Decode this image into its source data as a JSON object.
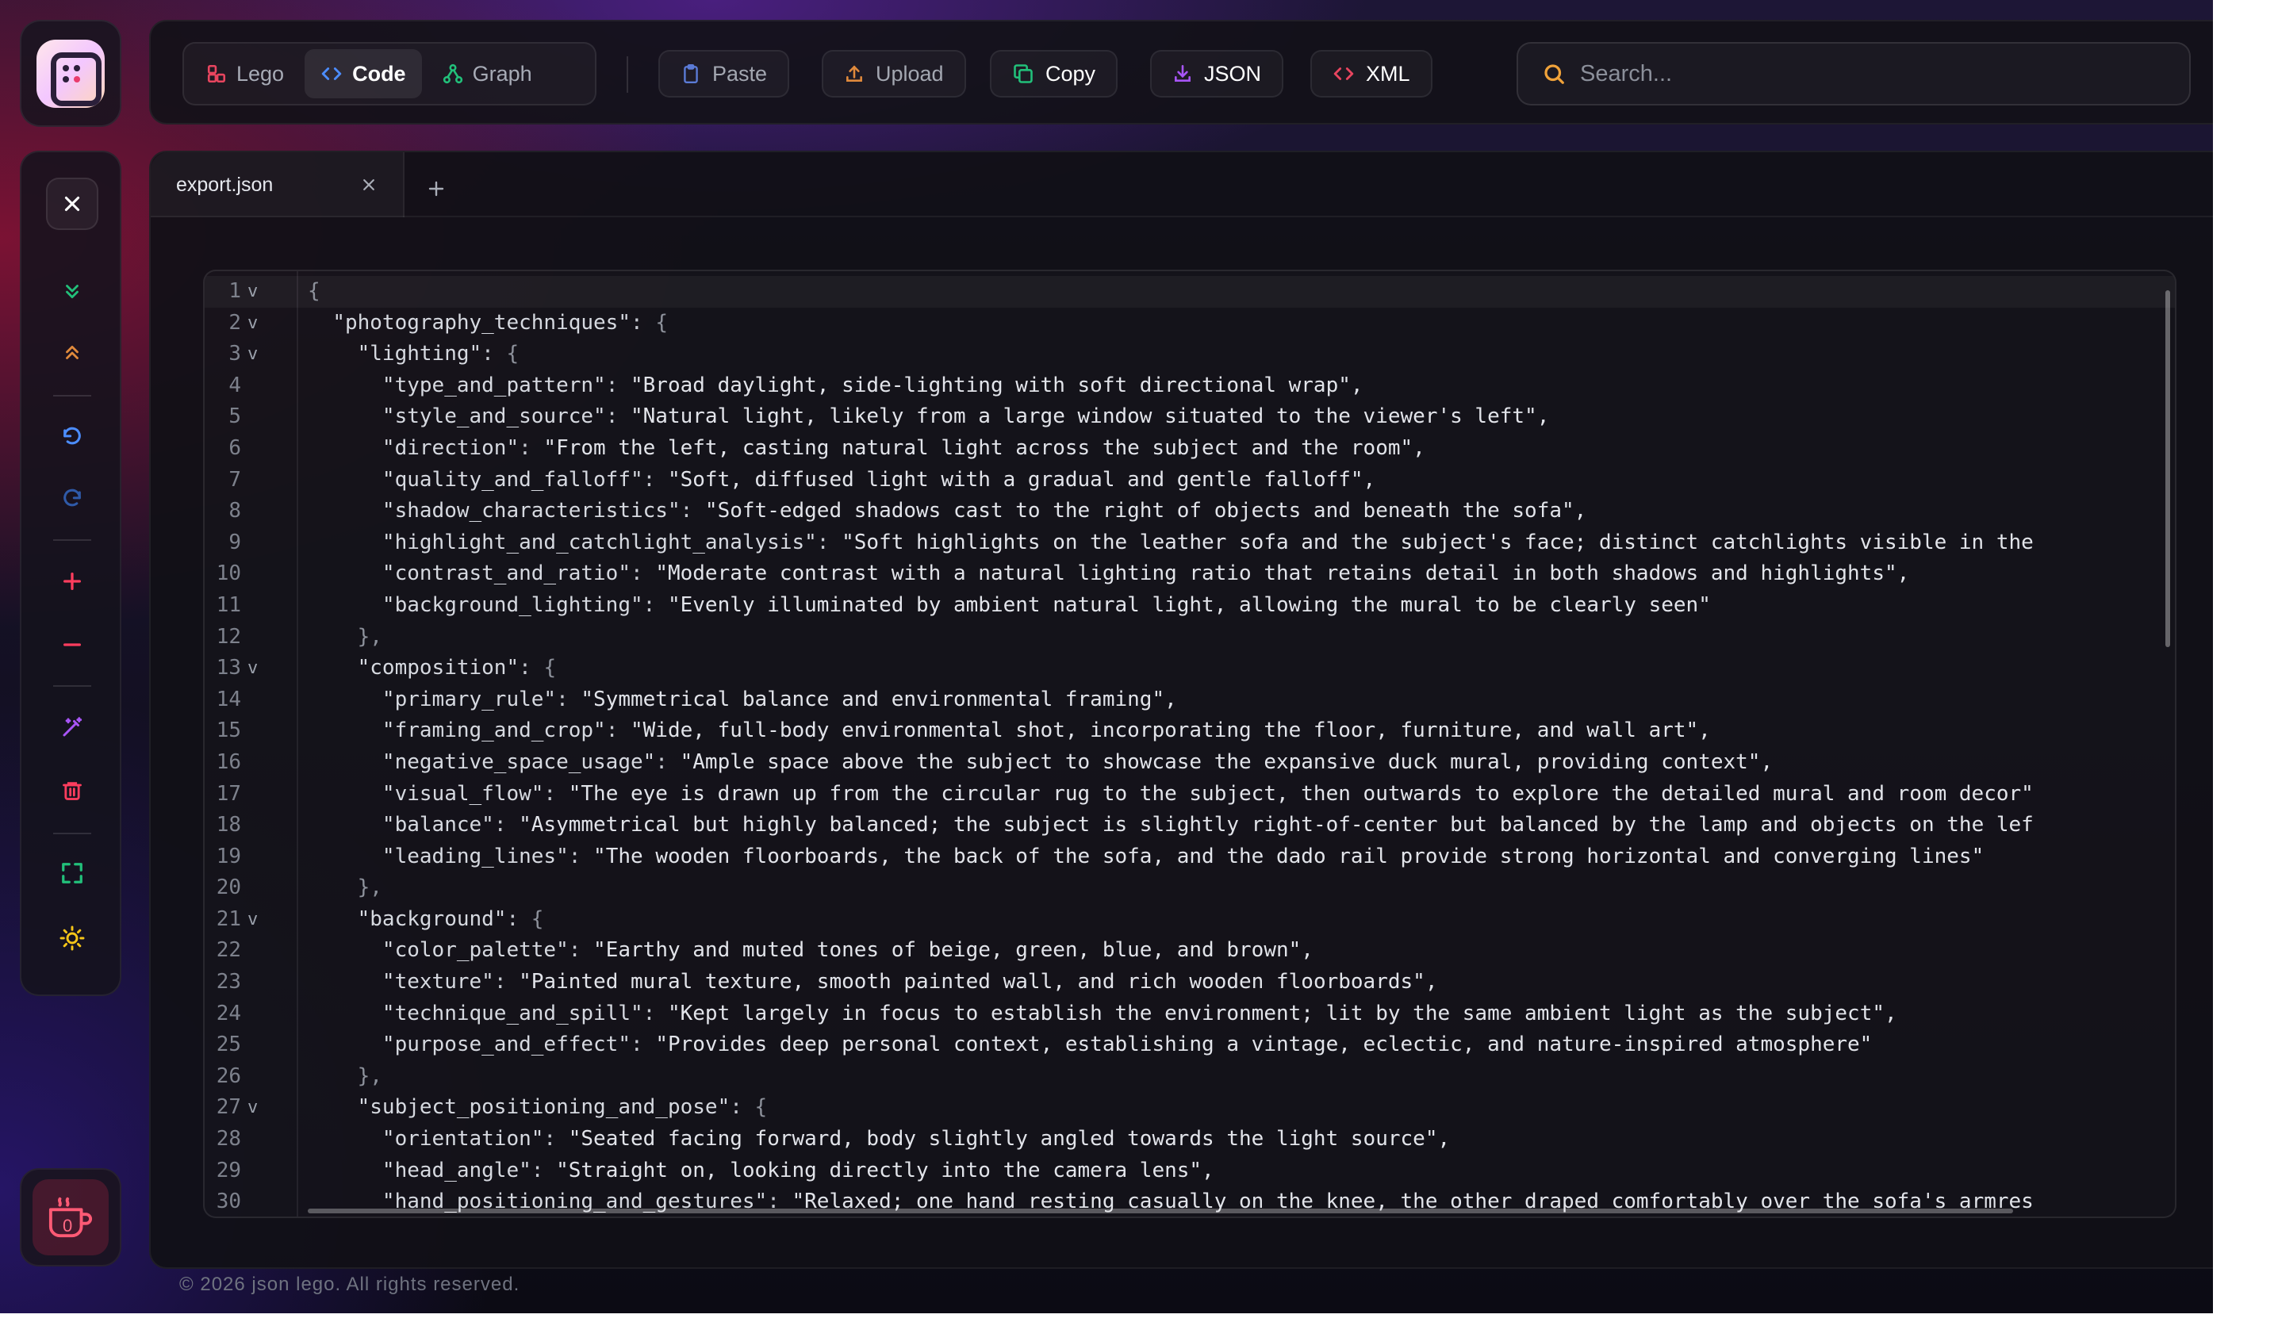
{
  "app": {
    "logo_icon": "json-lego-logo-icon",
    "footer": "© 2026 json lego. All rights reserved."
  },
  "modes": [
    {
      "label": "Lego",
      "icon": "blocks-icon",
      "color": "#e8455f",
      "active": false
    },
    {
      "label": "Code",
      "icon": "code-icon",
      "color": "#4c8dff",
      "active": true
    },
    {
      "label": "Graph",
      "icon": "graph-icon",
      "color": "#22c07a",
      "active": false
    }
  ],
  "toolbar": {
    "paste": "Paste",
    "upload": "Upload",
    "copy": "Copy",
    "json": "JSON",
    "xml": "XML",
    "search_placeholder": "Search...",
    "colors": {
      "paste": "#5b7bd6",
      "upload": "#e08a3c",
      "copy": "#22c07a",
      "json": "#a855f7",
      "xml": "#e8455f"
    }
  },
  "sidebar": {
    "tools": [
      "close-icon",
      "expand-all-icon",
      "collapse-all-icon",
      "undo-icon",
      "redo-icon",
      "zoom-in-icon",
      "zoom-out-icon",
      "magic-wand-icon",
      "trash-icon",
      "fullscreen-icon",
      "theme-sun-icon"
    ],
    "coffee_count": "0"
  },
  "editor": {
    "tab_name": "export.json",
    "current_line": 1,
    "lines": [
      {
        "n": "1",
        "fold": true,
        "indent": 0,
        "text": "{"
      },
      {
        "n": "2",
        "fold": true,
        "indent": 1,
        "key": "photography_techniques",
        "text": "{"
      },
      {
        "n": "3",
        "fold": true,
        "indent": 2,
        "key": "lighting",
        "text": "{"
      },
      {
        "n": "4",
        "fold": false,
        "indent": 3,
        "key": "type_and_pattern",
        "str": "Broad daylight, side-lighting with soft directional wrap",
        "comma": true
      },
      {
        "n": "5",
        "fold": false,
        "indent": 3,
        "key": "style_and_source",
        "str": "Natural light, likely from a large window situated to the viewer's left",
        "comma": true
      },
      {
        "n": "6",
        "fold": false,
        "indent": 3,
        "key": "direction",
        "str": "From the left, casting natural light across the subject and the room",
        "comma": true
      },
      {
        "n": "7",
        "fold": false,
        "indent": 3,
        "key": "quality_and_falloff",
        "str": "Soft, diffused light with a gradual and gentle falloff",
        "comma": true
      },
      {
        "n": "8",
        "fold": false,
        "indent": 3,
        "key": "shadow_characteristics",
        "str": "Soft-edged shadows cast to the right of objects and beneath the sofa",
        "comma": true
      },
      {
        "n": "9",
        "fold": false,
        "indent": 3,
        "key": "highlight_and_catchlight_analysis",
        "str": "Soft highlights on the leather sofa and the subject's face; distinct catchlights visible in the",
        "comma": false,
        "open": true
      },
      {
        "n": "10",
        "fold": false,
        "indent": 3,
        "key": "contrast_and_ratio",
        "str": "Moderate contrast with a natural lighting ratio that retains detail in both shadows and highlights",
        "comma": true
      },
      {
        "n": "11",
        "fold": false,
        "indent": 3,
        "key": "background_lighting",
        "str": "Evenly illuminated by ambient natural light, allowing the mural to be clearly seen",
        "comma": false
      },
      {
        "n": "12",
        "fold": false,
        "indent": 2,
        "text": "},"
      },
      {
        "n": "13",
        "fold": true,
        "indent": 2,
        "key": "composition",
        "text": "{"
      },
      {
        "n": "14",
        "fold": false,
        "indent": 3,
        "key": "primary_rule",
        "str": "Symmetrical balance and environmental framing",
        "comma": true
      },
      {
        "n": "15",
        "fold": false,
        "indent": 3,
        "key": "framing_and_crop",
        "str": "Wide, full-body environmental shot, incorporating the floor, furniture, and wall art",
        "comma": true
      },
      {
        "n": "16",
        "fold": false,
        "indent": 3,
        "key": "negative_space_usage",
        "str": "Ample space above the subject to showcase the expansive duck mural, providing context",
        "comma": true
      },
      {
        "n": "17",
        "fold": false,
        "indent": 3,
        "key": "visual_flow",
        "str": "The eye is drawn up from the circular rug to the subject, then outwards to explore the detailed mural and room decor",
        "comma": false
      },
      {
        "n": "18",
        "fold": false,
        "indent": 3,
        "key": "balance",
        "str": "Asymmetrical but highly balanced; the subject is slightly right-of-center but balanced by the lamp and objects on the lef",
        "comma": false,
        "open": true
      },
      {
        "n": "19",
        "fold": false,
        "indent": 3,
        "key": "leading_lines",
        "str": "The wooden floorboards, the back of the sofa, and the dado rail provide strong horizontal and converging lines",
        "comma": false
      },
      {
        "n": "20",
        "fold": false,
        "indent": 2,
        "text": "},"
      },
      {
        "n": "21",
        "fold": true,
        "indent": 2,
        "key": "background",
        "text": "{"
      },
      {
        "n": "22",
        "fold": false,
        "indent": 3,
        "key": "color_palette",
        "str": "Earthy and muted tones of beige, green, blue, and brown",
        "comma": true
      },
      {
        "n": "23",
        "fold": false,
        "indent": 3,
        "key": "texture",
        "str": "Painted mural texture, smooth painted wall, and rich wooden floorboards",
        "comma": true
      },
      {
        "n": "24",
        "fold": false,
        "indent": 3,
        "key": "technique_and_spill",
        "str": "Kept largely in focus to establish the environment; lit by the same ambient light as the subject",
        "comma": true
      },
      {
        "n": "25",
        "fold": false,
        "indent": 3,
        "key": "purpose_and_effect",
        "str": "Provides deep personal context, establishing a vintage, eclectic, and nature-inspired atmosphere",
        "comma": false
      },
      {
        "n": "26",
        "fold": false,
        "indent": 2,
        "text": "},"
      },
      {
        "n": "27",
        "fold": true,
        "indent": 2,
        "key": "subject_positioning_and_pose",
        "text": "{"
      },
      {
        "n": "28",
        "fold": false,
        "indent": 3,
        "key": "orientation",
        "str": "Seated facing forward, body slightly angled towards the light source",
        "comma": true
      },
      {
        "n": "29",
        "fold": false,
        "indent": 3,
        "key": "head_angle",
        "str": "Straight on, looking directly into the camera lens",
        "comma": true
      },
      {
        "n": "30",
        "fold": false,
        "indent": 3,
        "key": "hand_positioning_and_gestures",
        "str": "Relaxed; one hand resting casually on the knee, the other draped comfortably over the sofa's armres",
        "comma": false,
        "open": true
      }
    ]
  }
}
